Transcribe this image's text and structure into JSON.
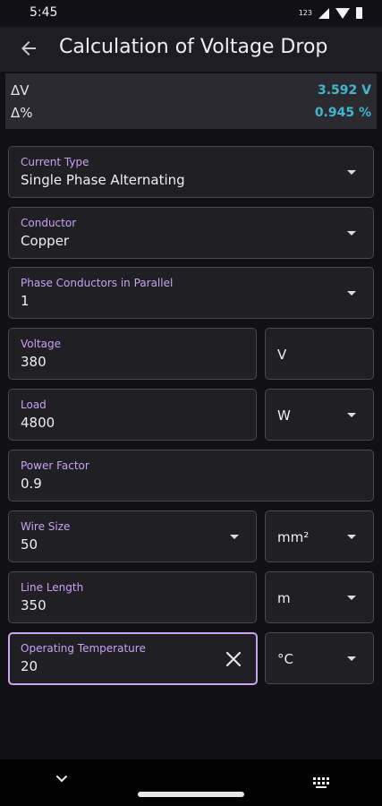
{
  "status_bar": {
    "time": "5:45",
    "network_label": "123"
  },
  "app_bar": {
    "back_icon": "arrow-back-icon",
    "title": "Calculation of Voltage Drop"
  },
  "results": {
    "delta_v": {
      "label": "ΔV",
      "value": "3.592 V"
    },
    "delta_percent": {
      "label": "Δ%",
      "value": "0.945 %"
    },
    "value_color": "#3fb7cf"
  },
  "form": {
    "current_type": {
      "label": "Current Type",
      "value": "Single Phase Alternating"
    },
    "conductor": {
      "label": "Conductor",
      "value": "Copper"
    },
    "phase_conductors": {
      "label": "Phase Conductors in Parallel",
      "value": "1"
    },
    "voltage": {
      "label": "Voltage",
      "value": "380",
      "unit": "V"
    },
    "load": {
      "label": "Load",
      "value": "4800",
      "unit": "W"
    },
    "power_factor": {
      "label": "Power Factor",
      "value": "0.9"
    },
    "wire_size": {
      "label": "Wire Size",
      "value": "50",
      "unit": "mm²"
    },
    "line_length": {
      "label": "Line Length",
      "value": "350",
      "unit": "m"
    },
    "operating_temperature": {
      "label": "Operating Temperature",
      "value": "20",
      "unit": "°C"
    }
  },
  "theme": {
    "accent": "#c6a2f3",
    "background": "#111014",
    "surface": "#201f24"
  },
  "nav_bar": {
    "icons": [
      "chevron-down-icon",
      "home-pill",
      "keyboard-icon"
    ]
  }
}
